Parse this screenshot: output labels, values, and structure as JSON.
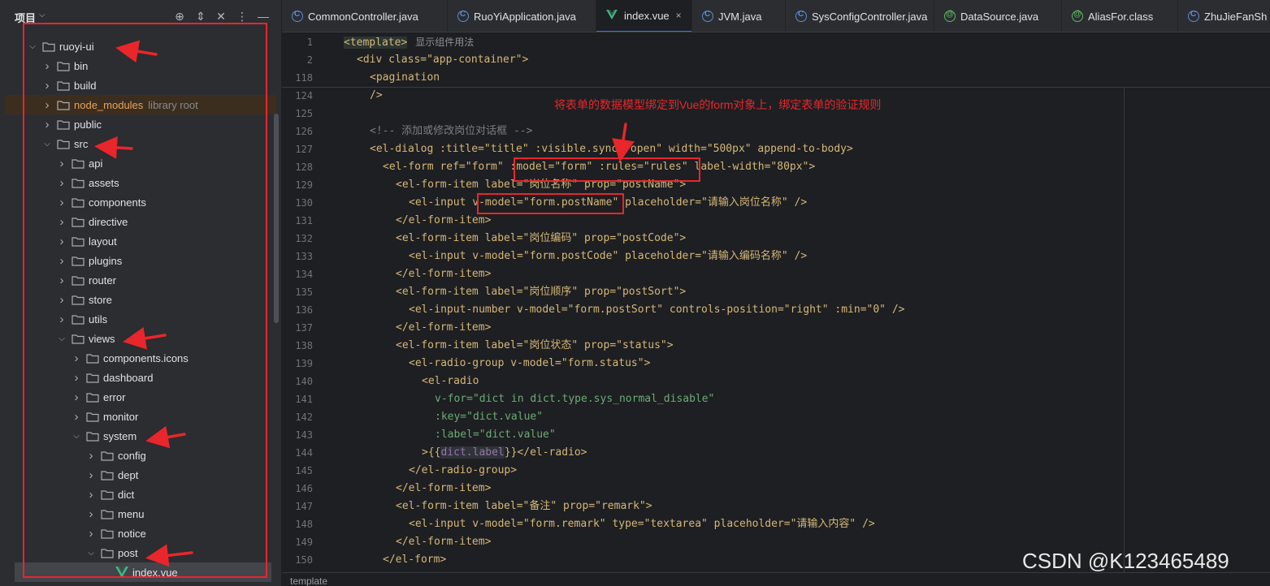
{
  "project_panel": {
    "title": "项目",
    "tree": [
      {
        "label": "ruoyi-ui",
        "depth": 0,
        "open": true
      },
      {
        "label": "bin",
        "depth": 1,
        "open": false
      },
      {
        "label": "build",
        "depth": 1,
        "open": false
      },
      {
        "label": "node_modules",
        "hint": "library root",
        "depth": 1,
        "open": false,
        "excluded": true
      },
      {
        "label": "public",
        "depth": 1,
        "open": false
      },
      {
        "label": "src",
        "depth": 1,
        "open": true
      },
      {
        "label": "api",
        "depth": 2,
        "open": false
      },
      {
        "label": "assets",
        "depth": 2,
        "open": false
      },
      {
        "label": "components",
        "depth": 2,
        "open": false
      },
      {
        "label": "directive",
        "depth": 2,
        "open": false
      },
      {
        "label": "layout",
        "depth": 2,
        "open": false
      },
      {
        "label": "plugins",
        "depth": 2,
        "open": false
      },
      {
        "label": "router",
        "depth": 2,
        "open": false
      },
      {
        "label": "store",
        "depth": 2,
        "open": false
      },
      {
        "label": "utils",
        "depth": 2,
        "open": false
      },
      {
        "label": "views",
        "depth": 2,
        "open": true
      },
      {
        "label": "components.icons",
        "depth": 3,
        "open": false
      },
      {
        "label": "dashboard",
        "depth": 3,
        "open": false
      },
      {
        "label": "error",
        "depth": 3,
        "open": false
      },
      {
        "label": "monitor",
        "depth": 3,
        "open": false
      },
      {
        "label": "system",
        "depth": 3,
        "open": true
      },
      {
        "label": "config",
        "depth": 4,
        "open": false
      },
      {
        "label": "dept",
        "depth": 4,
        "open": false
      },
      {
        "label": "dict",
        "depth": 4,
        "open": false
      },
      {
        "label": "menu",
        "depth": 4,
        "open": false
      },
      {
        "label": "notice",
        "depth": 4,
        "open": false
      },
      {
        "label": "post",
        "depth": 4,
        "open": true
      },
      {
        "label": "index.vue",
        "depth": 5,
        "file": true,
        "selected": true
      }
    ]
  },
  "tabs": [
    {
      "label": "CommonController.java",
      "icon": "class-icon"
    },
    {
      "label": "RuoYiApplication.java",
      "icon": "class-icon"
    },
    {
      "label": "index.vue",
      "icon": "vue-icon",
      "active": true,
      "close": "×"
    },
    {
      "label": "JVM.java",
      "icon": "class-icon"
    },
    {
      "label": "SysConfigController.java",
      "icon": "class-icon"
    },
    {
      "label": "DataSource.java",
      "icon": "annotation-icon"
    },
    {
      "label": "AliasFor.class",
      "icon": "annotation-icon"
    },
    {
      "label": "ZhuJieFanSh",
      "icon": "class-icon"
    }
  ],
  "gutter": [
    "1",
    "2",
    "118",
    "124",
    "125",
    "126",
    "127",
    "128",
    "129",
    "130",
    "131",
    "132",
    "133",
    "134",
    "135",
    "136",
    "137",
    "138",
    "139",
    "140",
    "141",
    "142",
    "143",
    "144",
    "145",
    "146",
    "147",
    "148",
    "149",
    "150"
  ],
  "code": {
    "l1_tag": "<template>",
    "l1_hint": "显示组件用法",
    "l2": "<div class=\"app-container\">",
    "l118": "<pagination",
    "l124": "/>",
    "l126": "<!-- 添加或修改岗位对话框 -->",
    "l127": "<el-dialog :title=\"title\" :visible.sync=\"open\" width=\"500px\" append-to-body>",
    "l128": "<el-form ref=\"form\" :model=\"form\" :rules=\"rules\" label-width=\"80px\">",
    "l129": "<el-form-item label=\"岗位名称\" prop=\"postName\">",
    "l130": "<el-input v-model=\"form.postName\" placeholder=\"请输入岗位名称\" />",
    "l131": "</el-form-item>",
    "l132": "<el-form-item label=\"岗位编码\" prop=\"postCode\">",
    "l133": "<el-input v-model=\"form.postCode\" placeholder=\"请输入编码名称\" />",
    "l134": "</el-form-item>",
    "l135": "<el-form-item label=\"岗位顺序\" prop=\"postSort\">",
    "l136": "<el-input-number v-model=\"form.postSort\" controls-position=\"right\" :min=\"0\" />",
    "l137": "</el-form-item>",
    "l138": "<el-form-item label=\"岗位状态\" prop=\"status\">",
    "l139": "<el-radio-group v-model=\"form.status\">",
    "l140": "<el-radio",
    "l141": "v-for=\"dict in dict.type.sys_normal_disable\"",
    "l142": ":key=\"dict.value\"",
    "l143": ":label=\"dict.value\"",
    "l144a": ">{{",
    "l144b": "dict.label",
    "l144c": "}}</el-radio>",
    "l145": "</el-radio-group>",
    "l146": "</el-form-item>",
    "l147": "<el-form-item label=\"备注\" prop=\"remark\">",
    "l148": "<el-input v-model=\"form.remark\" type=\"textarea\" placeholder=\"请输入内容\" />",
    "l149": "</el-form-item>",
    "l150": "</el-form>"
  },
  "status": {
    "breadcrumb": "template"
  },
  "annotation": {
    "caption": "将表单的数据模型绑定到Vue的form对象上，绑定表单的验证规则"
  },
  "watermark": "CSDN @K123465489",
  "colors": {
    "annotation_red": "#e8262b",
    "tag": "#d5b778",
    "string": "#6aab73",
    "accent": "#3574f0"
  }
}
